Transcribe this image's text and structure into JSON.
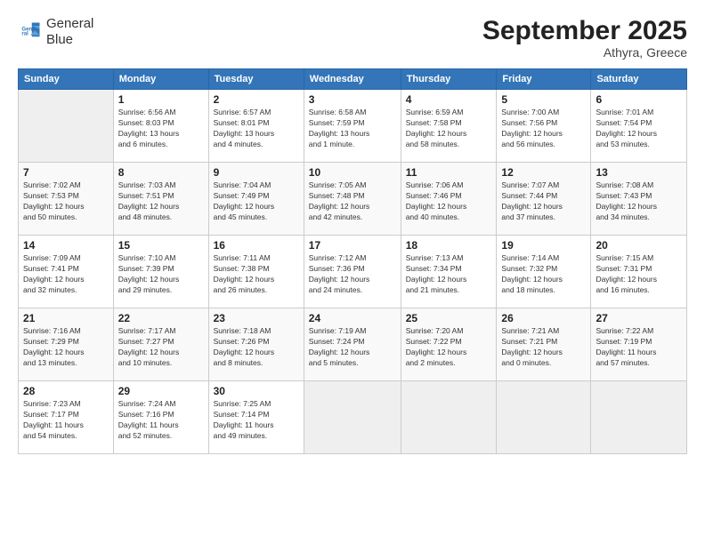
{
  "logo": {
    "line1": "General",
    "line2": "Blue"
  },
  "title": "September 2025",
  "location": "Athyra, Greece",
  "days_header": [
    "Sunday",
    "Monday",
    "Tuesday",
    "Wednesday",
    "Thursday",
    "Friday",
    "Saturday"
  ],
  "weeks": [
    [
      {
        "num": "",
        "info": ""
      },
      {
        "num": "1",
        "info": "Sunrise: 6:56 AM\nSunset: 8:03 PM\nDaylight: 13 hours\nand 6 minutes."
      },
      {
        "num": "2",
        "info": "Sunrise: 6:57 AM\nSunset: 8:01 PM\nDaylight: 13 hours\nand 4 minutes."
      },
      {
        "num": "3",
        "info": "Sunrise: 6:58 AM\nSunset: 7:59 PM\nDaylight: 13 hours\nand 1 minute."
      },
      {
        "num": "4",
        "info": "Sunrise: 6:59 AM\nSunset: 7:58 PM\nDaylight: 12 hours\nand 58 minutes."
      },
      {
        "num": "5",
        "info": "Sunrise: 7:00 AM\nSunset: 7:56 PM\nDaylight: 12 hours\nand 56 minutes."
      },
      {
        "num": "6",
        "info": "Sunrise: 7:01 AM\nSunset: 7:54 PM\nDaylight: 12 hours\nand 53 minutes."
      }
    ],
    [
      {
        "num": "7",
        "info": "Sunrise: 7:02 AM\nSunset: 7:53 PM\nDaylight: 12 hours\nand 50 minutes."
      },
      {
        "num": "8",
        "info": "Sunrise: 7:03 AM\nSunset: 7:51 PM\nDaylight: 12 hours\nand 48 minutes."
      },
      {
        "num": "9",
        "info": "Sunrise: 7:04 AM\nSunset: 7:49 PM\nDaylight: 12 hours\nand 45 minutes."
      },
      {
        "num": "10",
        "info": "Sunrise: 7:05 AM\nSunset: 7:48 PM\nDaylight: 12 hours\nand 42 minutes."
      },
      {
        "num": "11",
        "info": "Sunrise: 7:06 AM\nSunset: 7:46 PM\nDaylight: 12 hours\nand 40 minutes."
      },
      {
        "num": "12",
        "info": "Sunrise: 7:07 AM\nSunset: 7:44 PM\nDaylight: 12 hours\nand 37 minutes."
      },
      {
        "num": "13",
        "info": "Sunrise: 7:08 AM\nSunset: 7:43 PM\nDaylight: 12 hours\nand 34 minutes."
      }
    ],
    [
      {
        "num": "14",
        "info": "Sunrise: 7:09 AM\nSunset: 7:41 PM\nDaylight: 12 hours\nand 32 minutes."
      },
      {
        "num": "15",
        "info": "Sunrise: 7:10 AM\nSunset: 7:39 PM\nDaylight: 12 hours\nand 29 minutes."
      },
      {
        "num": "16",
        "info": "Sunrise: 7:11 AM\nSunset: 7:38 PM\nDaylight: 12 hours\nand 26 minutes."
      },
      {
        "num": "17",
        "info": "Sunrise: 7:12 AM\nSunset: 7:36 PM\nDaylight: 12 hours\nand 24 minutes."
      },
      {
        "num": "18",
        "info": "Sunrise: 7:13 AM\nSunset: 7:34 PM\nDaylight: 12 hours\nand 21 minutes."
      },
      {
        "num": "19",
        "info": "Sunrise: 7:14 AM\nSunset: 7:32 PM\nDaylight: 12 hours\nand 18 minutes."
      },
      {
        "num": "20",
        "info": "Sunrise: 7:15 AM\nSunset: 7:31 PM\nDaylight: 12 hours\nand 16 minutes."
      }
    ],
    [
      {
        "num": "21",
        "info": "Sunrise: 7:16 AM\nSunset: 7:29 PM\nDaylight: 12 hours\nand 13 minutes."
      },
      {
        "num": "22",
        "info": "Sunrise: 7:17 AM\nSunset: 7:27 PM\nDaylight: 12 hours\nand 10 minutes."
      },
      {
        "num": "23",
        "info": "Sunrise: 7:18 AM\nSunset: 7:26 PM\nDaylight: 12 hours\nand 8 minutes."
      },
      {
        "num": "24",
        "info": "Sunrise: 7:19 AM\nSunset: 7:24 PM\nDaylight: 12 hours\nand 5 minutes."
      },
      {
        "num": "25",
        "info": "Sunrise: 7:20 AM\nSunset: 7:22 PM\nDaylight: 12 hours\nand 2 minutes."
      },
      {
        "num": "26",
        "info": "Sunrise: 7:21 AM\nSunset: 7:21 PM\nDaylight: 12 hours\nand 0 minutes."
      },
      {
        "num": "27",
        "info": "Sunrise: 7:22 AM\nSunset: 7:19 PM\nDaylight: 11 hours\nand 57 minutes."
      }
    ],
    [
      {
        "num": "28",
        "info": "Sunrise: 7:23 AM\nSunset: 7:17 PM\nDaylight: 11 hours\nand 54 minutes."
      },
      {
        "num": "29",
        "info": "Sunrise: 7:24 AM\nSunset: 7:16 PM\nDaylight: 11 hours\nand 52 minutes."
      },
      {
        "num": "30",
        "info": "Sunrise: 7:25 AM\nSunset: 7:14 PM\nDaylight: 11 hours\nand 49 minutes."
      },
      {
        "num": "",
        "info": ""
      },
      {
        "num": "",
        "info": ""
      },
      {
        "num": "",
        "info": ""
      },
      {
        "num": "",
        "info": ""
      }
    ]
  ]
}
